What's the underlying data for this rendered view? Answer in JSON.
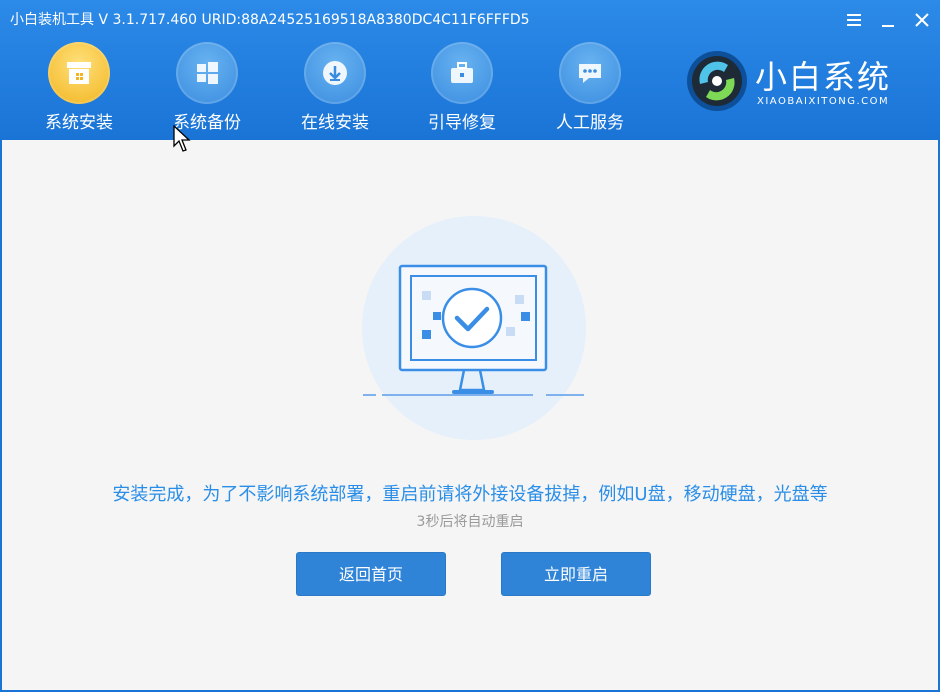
{
  "window": {
    "title": "小白装机工具 V 3.1.717.460 URID:88A24525169518A8380DC4C11F6FFFD5"
  },
  "nav": {
    "items": [
      {
        "label": "系统安装",
        "icon": "box-icon",
        "active": true
      },
      {
        "label": "系统备份",
        "icon": "windows-icon",
        "active": false
      },
      {
        "label": "在线安装",
        "icon": "download-icon",
        "active": false
      },
      {
        "label": "引导修复",
        "icon": "toolbox-icon",
        "active": false
      },
      {
        "label": "人工服务",
        "icon": "chat-icon",
        "active": false
      }
    ]
  },
  "brand": {
    "name": "小白系统",
    "subtitle": "XIAOBAIXITONG.COM"
  },
  "main": {
    "message": "安装完成，为了不影响系统部署，重启前请将外接设备拔掉，例如U盘，移动硬盘，光盘等",
    "countdown": "3秒后将自动重启",
    "home_button": "返回首页",
    "restart_button": "立即重启"
  },
  "colors": {
    "header": "#1a74d6",
    "accent": "#2a8ee8",
    "button": "#2f84d8",
    "active_nav": "#f2b41f"
  }
}
